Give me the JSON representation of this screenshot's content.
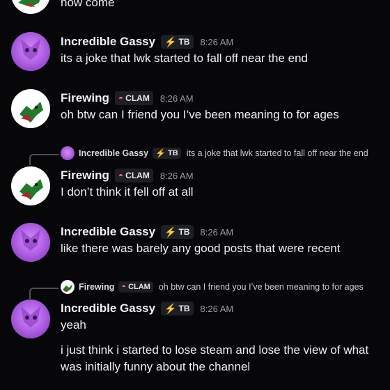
{
  "messages": [
    {
      "body": "now come"
    },
    {
      "author": "Incredible Gassy",
      "tag": "TB",
      "time": "8:26 AM",
      "body": "its a joke that lwk started to fall off near the end"
    },
    {
      "author": "Firewing",
      "tag": "CLAM",
      "time": "8:26 AM",
      "body": "oh btw can I friend you I’ve been meaning to for ages"
    },
    {
      "reply": {
        "author": "Incredible Gassy",
        "tag": "TB",
        "text": "its a joke that lwk started to fall off near the end"
      },
      "author": "Firewing",
      "tag": "CLAM",
      "time": "8:26 AM",
      "body": "I don’t think it fell off at all"
    },
    {
      "author": "Incredible Gassy",
      "tag": "TB",
      "time": "8:26 AM",
      "body": "like there was barely any good posts that were recent"
    },
    {
      "reply": {
        "author": "Firewing",
        "tag": "CLAM",
        "text": "oh btw can I friend you I’ve been meaning to for ages"
      },
      "author": "Incredible Gassy",
      "tag": "TB",
      "time": "8:26 AM",
      "body": "yeah",
      "body2": "i just think i started to lose steam and lose the view of what",
      "body3": "was initially funny about the channel"
    }
  ],
  "colors": {
    "tb_bolt": "#e0557a",
    "clam": "#f07a8a",
    "background": "#070709"
  },
  "icons": {
    "tb": "bolt-icon",
    "clam": "clam-icon"
  }
}
